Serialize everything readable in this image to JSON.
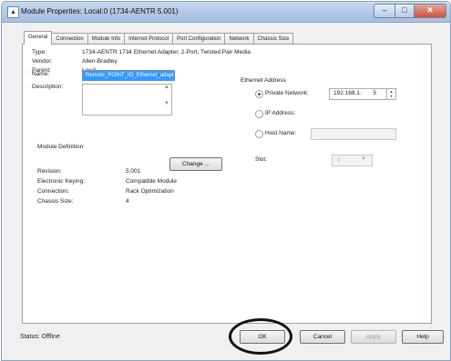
{
  "window": {
    "title": "Module Properties: Local:0 (1734-AENTR 5.001)",
    "icon": "app-icon",
    "caption": {
      "minimize": "–",
      "maximize": "□",
      "close": "✕"
    }
  },
  "tabs": [
    {
      "label": "General"
    },
    {
      "label": "Connection"
    },
    {
      "label": "Module Info"
    },
    {
      "label": "Internet Protocol"
    },
    {
      "label": "Port Configuration"
    },
    {
      "label": "Network"
    },
    {
      "label": "Chassis Size"
    }
  ],
  "general": {
    "type_label": "Type:",
    "type_value": "1734-AENTR 1734 Ethernet Adapter, 2-Port, Twisted Pair Media",
    "vendor_label": "Vendor:",
    "vendor_value": "Allen-Bradley",
    "parent_label": "Parent:",
    "parent_value": "Local",
    "name_label": "Name:",
    "name_value": "Remote_POINT_IO_Ethernet_adapter",
    "description_label": "Description:",
    "description_value": ""
  },
  "module_definition": {
    "heading": "Module Definition",
    "change_button": "Change ...",
    "revision_label": "Revision:",
    "revision_value": "5.001",
    "keying_label": "Electronic Keying:",
    "keying_value": "Compatible Module",
    "connection_label": "Connection:",
    "connection_value": "Rack Optimization",
    "chassis_label": "Chassis Size:",
    "chassis_value": "4"
  },
  "ethernet": {
    "heading": "Ethernet Address",
    "private_label": "Private Network:",
    "private_prefix": "192.168.1.",
    "private_last": "5",
    "ip_label": "IP Address:",
    "host_label": "Host Name:",
    "slot_label": "Slot:",
    "slot_value": "0"
  },
  "footer": {
    "status": "Status:  Offline",
    "ok": "OK",
    "cancel": "Cancel",
    "apply": "Apply",
    "help": "Help"
  },
  "colors": {
    "selection": "#3399ff",
    "annotation_circle": "#111111"
  }
}
